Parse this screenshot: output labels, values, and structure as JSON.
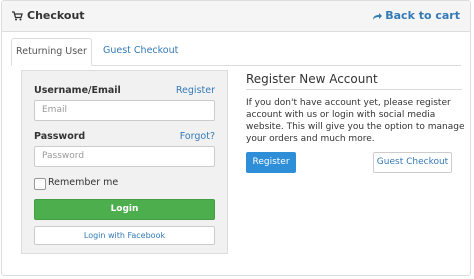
{
  "header": {
    "title": "Checkout",
    "back_label": "Back to cart"
  },
  "tabs": [
    {
      "label": "Returning User",
      "active": true
    },
    {
      "label": "Guest Checkout",
      "active": false
    }
  ],
  "login": {
    "username_label": "Username/Email",
    "register_link": "Register",
    "email_placeholder": "Email",
    "password_label": "Password",
    "forgot_link": "Forgot?",
    "password_placeholder": "Password",
    "remember_label": "Remember me",
    "login_button": "Login",
    "facebook_button": "Login with Facebook"
  },
  "register": {
    "title": "Register New Account",
    "description": "If you don't have account yet, please register account with us or login with social media website. This will give you the option to manage your orders and much more.",
    "register_button": "Register",
    "guest_button": "Guest Checkout"
  },
  "colors": {
    "primary": "#2e8fd8",
    "success": "#4cae4c",
    "link": "#337ab7"
  },
  "icons": {
    "header": "shopping-cart-icon",
    "back": "share-arrow-icon"
  }
}
